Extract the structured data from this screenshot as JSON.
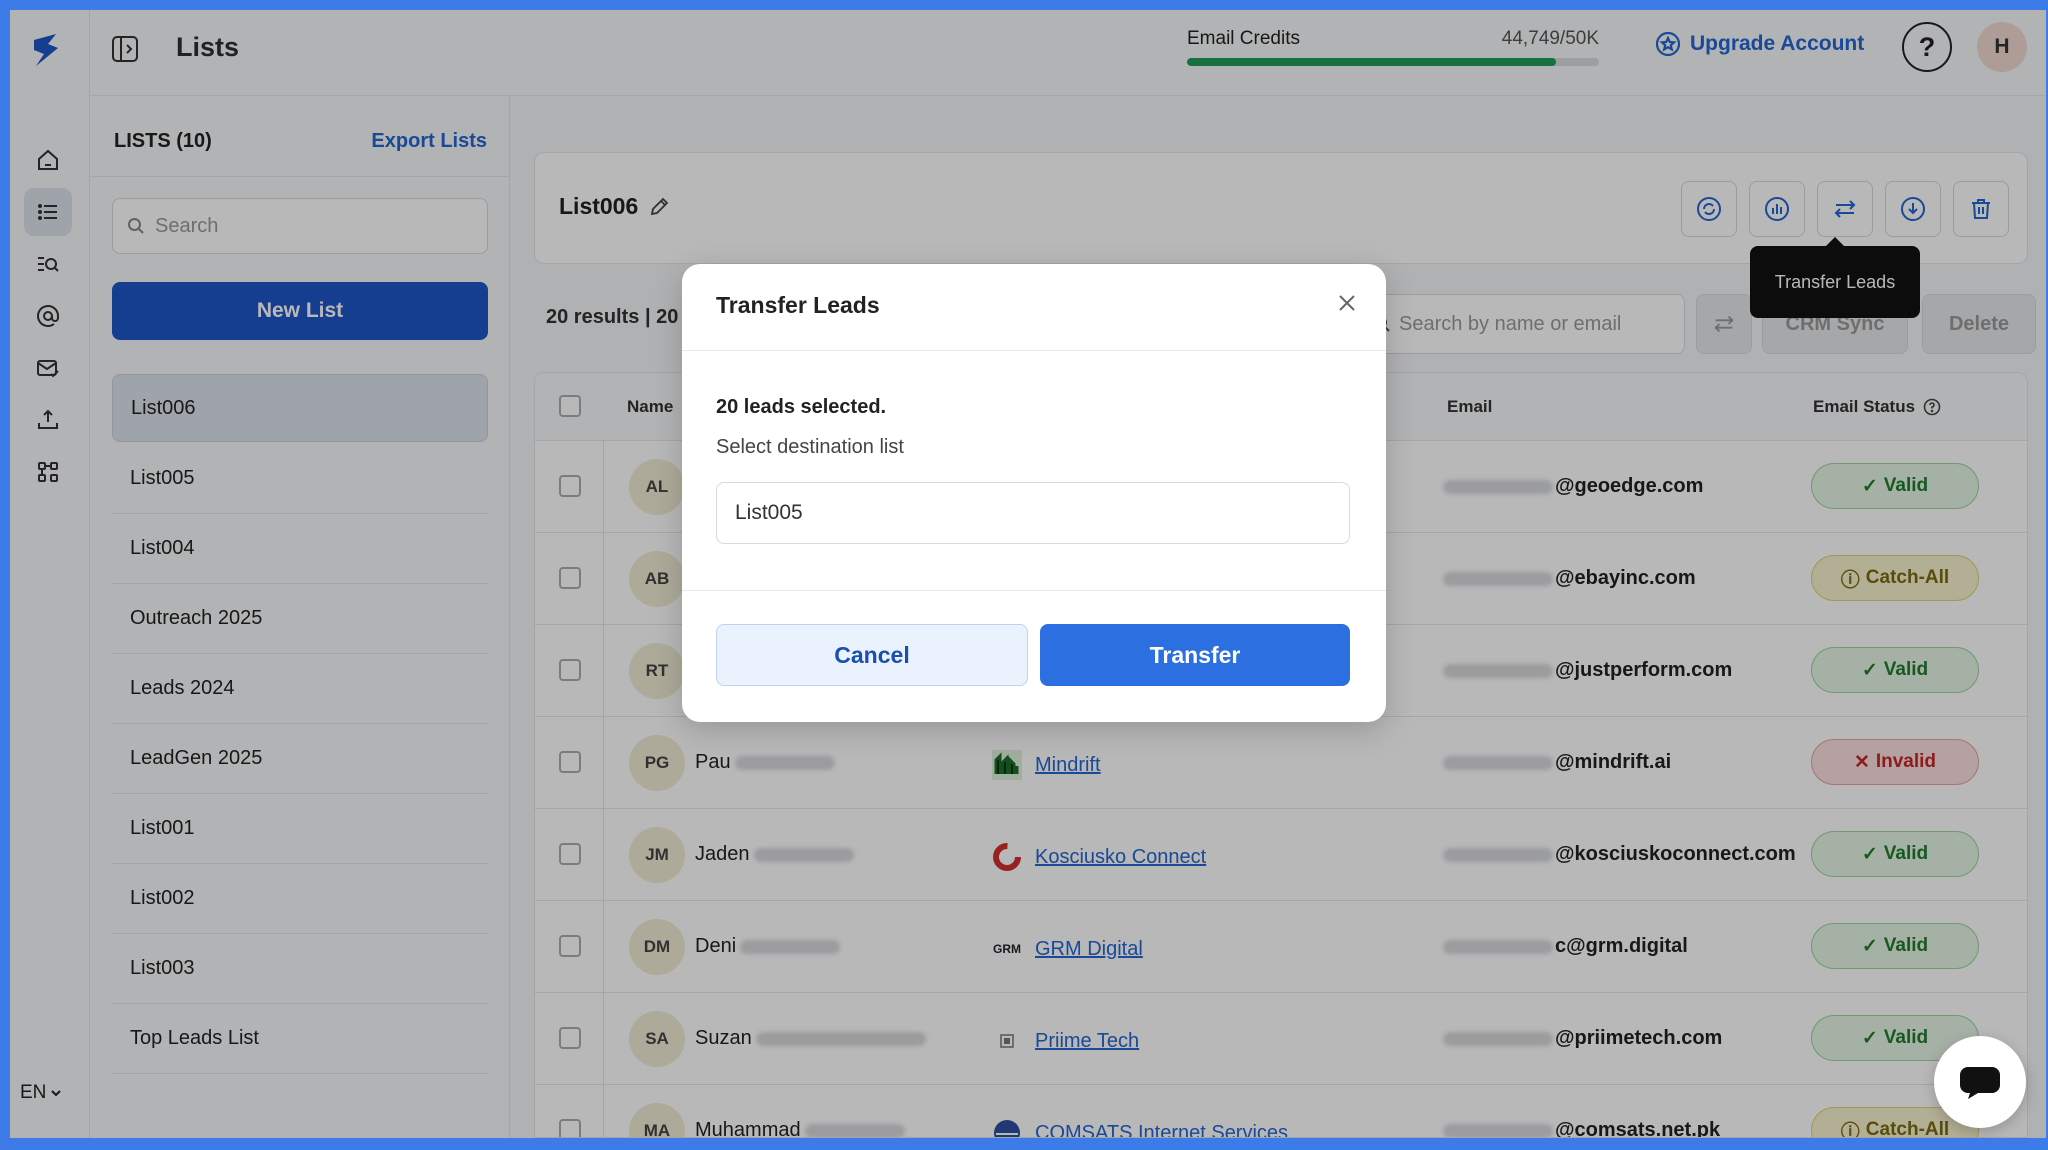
{
  "app": {
    "page_title": "Lists",
    "language": "EN"
  },
  "credits": {
    "label": "Email Credits",
    "value": "44,749/50K",
    "used_fraction": 0.895
  },
  "header": {
    "upgrade_label": "Upgrade Account",
    "help_label": "?",
    "avatar_initial": "H"
  },
  "lists_panel": {
    "heading": "LISTS (10)",
    "export_label": "Export Lists",
    "search_placeholder": "Search",
    "new_list_label": "New List",
    "items": [
      "List006",
      "List005",
      "List004",
      "Outreach 2025",
      "Leads 2024",
      "LeadGen 2025",
      "List001",
      "List002",
      "List003",
      "Top Leads List"
    ]
  },
  "main": {
    "list_name": "List006",
    "tooltip": "Transfer Leads",
    "results_text": "20 results | 20",
    "search_placeholder": "Search by name or email",
    "crm_sync_label": "CRM Sync",
    "delete_label": "Delete",
    "columns": {
      "name": "Name",
      "email": "Email",
      "email_status": "Email Status"
    }
  },
  "rows": [
    {
      "initials": "AL",
      "first": "",
      "company": "",
      "email": "@geoedge.com",
      "status": "Valid",
      "kind": "valid"
    },
    {
      "initials": "AB",
      "first": "",
      "company": "",
      "email": "@ebayinc.com",
      "status": "Catch-All",
      "kind": "catch"
    },
    {
      "initials": "RT",
      "first": "",
      "company": "",
      "email": "@justperform.com",
      "status": "Valid",
      "kind": "valid"
    },
    {
      "initials": "PG",
      "first": "Pau",
      "company": "Mindrift",
      "email": "@mindrift.ai",
      "status": "Invalid",
      "kind": "invalid"
    },
    {
      "initials": "JM",
      "first": "Jaden",
      "company": "Kosciusko Connect",
      "email": "@kosciuskoconnect.com",
      "status": "Valid",
      "kind": "valid"
    },
    {
      "initials": "DM",
      "first": "Deni",
      "company": "GRM Digital",
      "email": "c@grm.digital",
      "status": "Valid",
      "kind": "valid"
    },
    {
      "initials": "SA",
      "first": "Suzan",
      "company": "Priime Tech",
      "email": "@priimetech.com",
      "status": "Valid",
      "kind": "valid"
    },
    {
      "initials": "MA",
      "first": "Muhammad",
      "company": "COMSATS Internet Services",
      "email": "@comsats.net.pk",
      "status": "Catch-All",
      "kind": "catch"
    }
  ],
  "company_logo_text": {
    "grm": "GRM"
  },
  "modal": {
    "title": "Transfer Leads",
    "selected_text": "20 leads selected.",
    "select_label": "Select destination list",
    "selected_value": "List005",
    "cancel_label": "Cancel",
    "transfer_label": "Transfer"
  },
  "colors": {
    "accent": "#2b6fe0",
    "primary_dark": "#1f56c8",
    "valid": "#227a2e",
    "invalid": "#c62828",
    "catch_all": "#7a6a12"
  }
}
